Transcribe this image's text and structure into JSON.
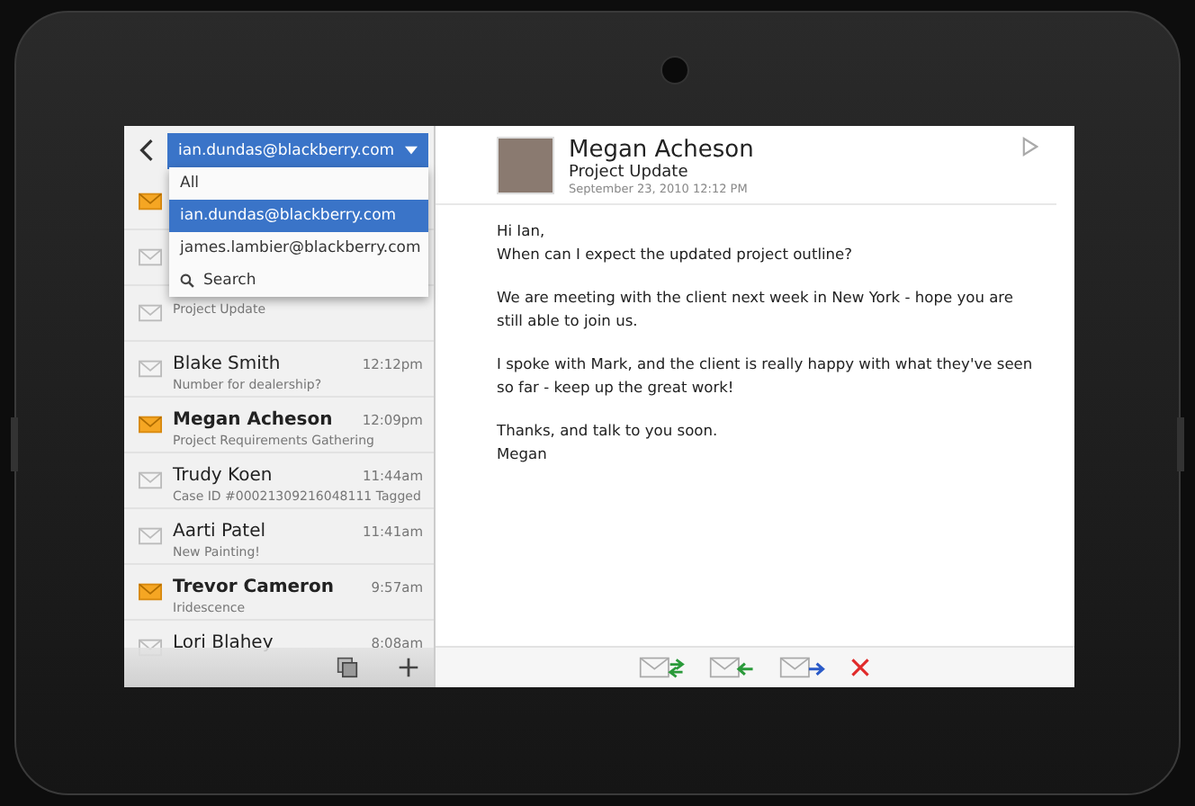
{
  "account_picker": {
    "value": "ian.dundas@blackberry.com",
    "options": [
      {
        "label": "All",
        "selected": false,
        "kind": "option"
      },
      {
        "label": "ian.dundas@blackberry.com",
        "selected": true,
        "kind": "option"
      },
      {
        "label": "james.lambier@blackberry.com",
        "selected": false,
        "kind": "option"
      },
      {
        "label": "Search",
        "selected": false,
        "kind": "search"
      }
    ]
  },
  "messages": [
    {
      "unread": true
    },
    {
      "unread": false
    },
    {
      "unread": false,
      "subject": "Project Update"
    },
    {
      "unread": false,
      "sender": "Blake Smith",
      "time": "12:12pm",
      "subject": "Number for dealership?"
    },
    {
      "unread": true,
      "sender": "Megan Acheson",
      "time": "12:09pm",
      "subject": "Project Requirements Gathering"
    },
    {
      "unread": false,
      "sender": "Trudy Koen",
      "time": "11:44am",
      "subject": "Case ID #00021309216048111 Tagged"
    },
    {
      "unread": false,
      "sender": "Aarti Patel",
      "time": "11:41am",
      "subject": "New Painting!"
    },
    {
      "unread": true,
      "sender": "Trevor Cameron",
      "time": "9:57am",
      "subject": "Iridescence"
    },
    {
      "unread": false,
      "sender": "Lori Blahey",
      "time": "8:08am"
    }
  ],
  "email": {
    "sender": "Megan Acheson",
    "subject": "Project Update",
    "date": "September 23, 2010 12:12 PM",
    "body": [
      "Hi Ian,\nWhen can I expect the updated project outline?",
      "We are meeting with the client next week in New York - hope you are still able to join us.",
      "I spoke with Mark, and the client is really happy with what they've seen so far - keep up the great work!",
      "Thanks, and talk to you soon.\nMegan"
    ]
  }
}
